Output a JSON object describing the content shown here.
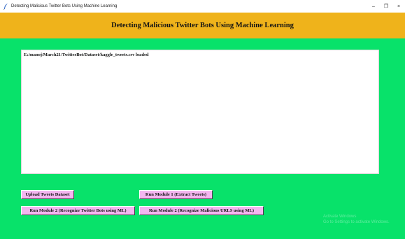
{
  "window": {
    "title": "Detecting Malicious Twitter Bots Using Machine Learning",
    "icon": "feather-icon",
    "controls": {
      "minimize": "–",
      "maximize": "❐",
      "close": "×"
    }
  },
  "header": {
    "title": "Detecting Malicious Twitter Bots Using Machine Learning"
  },
  "output": {
    "lines": [
      "E:/manoj/March21/TwitterBot/Dataset/kaggle_tweets.csv loaded"
    ]
  },
  "buttons": {
    "upload": "Upload Tweets Dataset",
    "module1": "Run Module 1 (Extract Tweets)",
    "module2_bots": "Run Module 2 (Recognize Twitter Bots using ML)",
    "module2_urls": "Run Module 2 (Recognize Malicious URLS using ML)"
  },
  "watermark": {
    "line1": "Activate Windows",
    "line2": "Go to Settings to activate Windows."
  },
  "colors": {
    "background": "#08e26a",
    "header": "#efb31b",
    "button": "#f4b6f0",
    "output_bg": "#ffffff"
  }
}
